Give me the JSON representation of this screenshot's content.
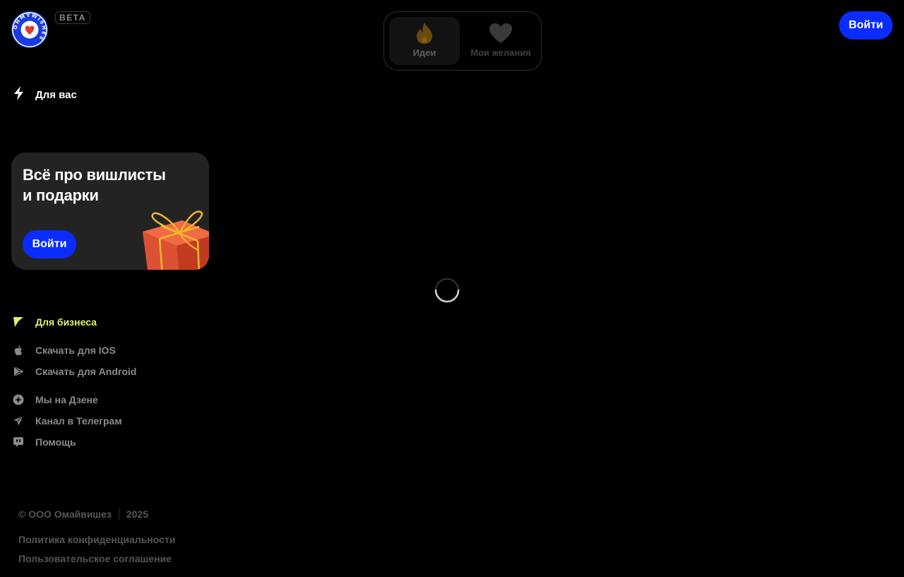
{
  "header": {
    "logo_icon": "heart-badge-icon",
    "logo_ring_text": "OHMYWISHES",
    "beta_label": "BETA",
    "login_label": "Войти",
    "accent_color": "#0a2cff"
  },
  "tabs": [
    {
      "label": "Идеи",
      "icon": "flame-icon",
      "active": true
    },
    {
      "label": "Мои желания",
      "icon": "heart-icon",
      "active": false
    }
  ],
  "sidebar": {
    "for_you_label": "Для вас",
    "for_you_icon": "lightning-icon",
    "promo": {
      "title_line1": "Всё про вишлисты",
      "title_line2": "и подарки",
      "button_label": "Войти",
      "image": "gift-box-image"
    },
    "business": {
      "label": "Для бизнеса",
      "icon": "flag-icon",
      "color": "#d8f46a"
    },
    "links": [
      {
        "label": "Скачать для IOS",
        "icon": "apple-icon"
      },
      {
        "label": "Скачать для Android",
        "icon": "google-play-icon"
      },
      {
        "label": "Мы на Дзене",
        "icon": "dzen-icon"
      },
      {
        "label": "Канал в Телеграм",
        "icon": "telegram-icon"
      },
      {
        "label": "Помощь",
        "icon": "help-chat-icon"
      }
    ]
  },
  "main": {
    "loading_indicator": "spinner"
  },
  "footer": {
    "copyright": "© ООО Омайвишез",
    "year": "2025",
    "privacy_label": "Политика конфиденциальности",
    "terms_label": "Пользовательское соглашение"
  }
}
